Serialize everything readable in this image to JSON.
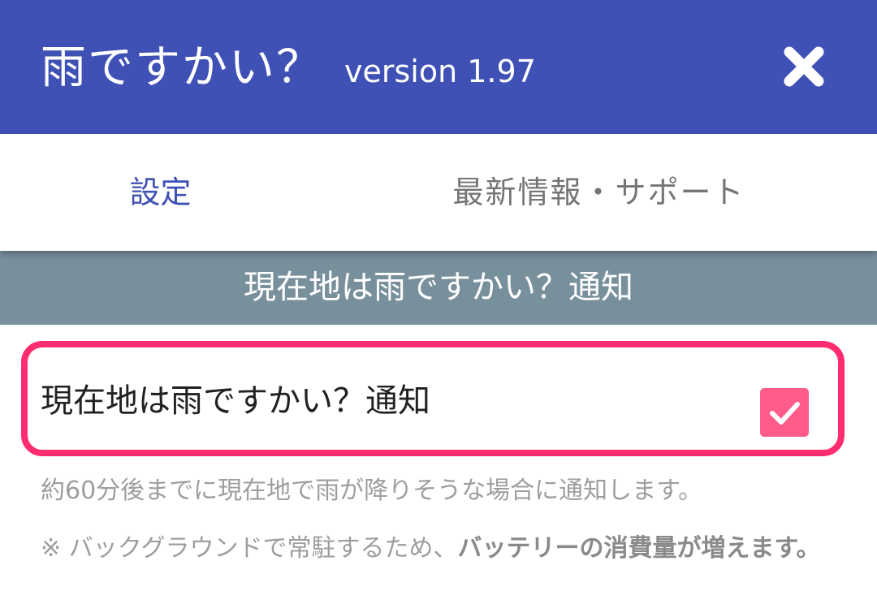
{
  "title_bar": {
    "app_name": "雨ですかい？",
    "version": "version 1.97",
    "close_icon": "close-icon",
    "background_color": "#3f51b5"
  },
  "tabs": [
    {
      "label": "設定",
      "selected": true
    },
    {
      "label": "最新情報・サポート",
      "selected": false
    }
  ],
  "section": {
    "title": "現在地は雨ですかい？通知",
    "background_color": "#78909c"
  },
  "setting": {
    "label": "現在地は雨ですかい？通知",
    "checked": true,
    "check_icon": "check-icon",
    "checkbox_color": "#ff5c8a",
    "highlight_color": "#ff2d6f"
  },
  "description": "約60分後までに現在地で雨が降りそうな場合に通知します。",
  "note": {
    "prefix": "※ バックグラウンドで常駐するため、",
    "emphasis": "バッテリーの消費量が増えます。"
  }
}
